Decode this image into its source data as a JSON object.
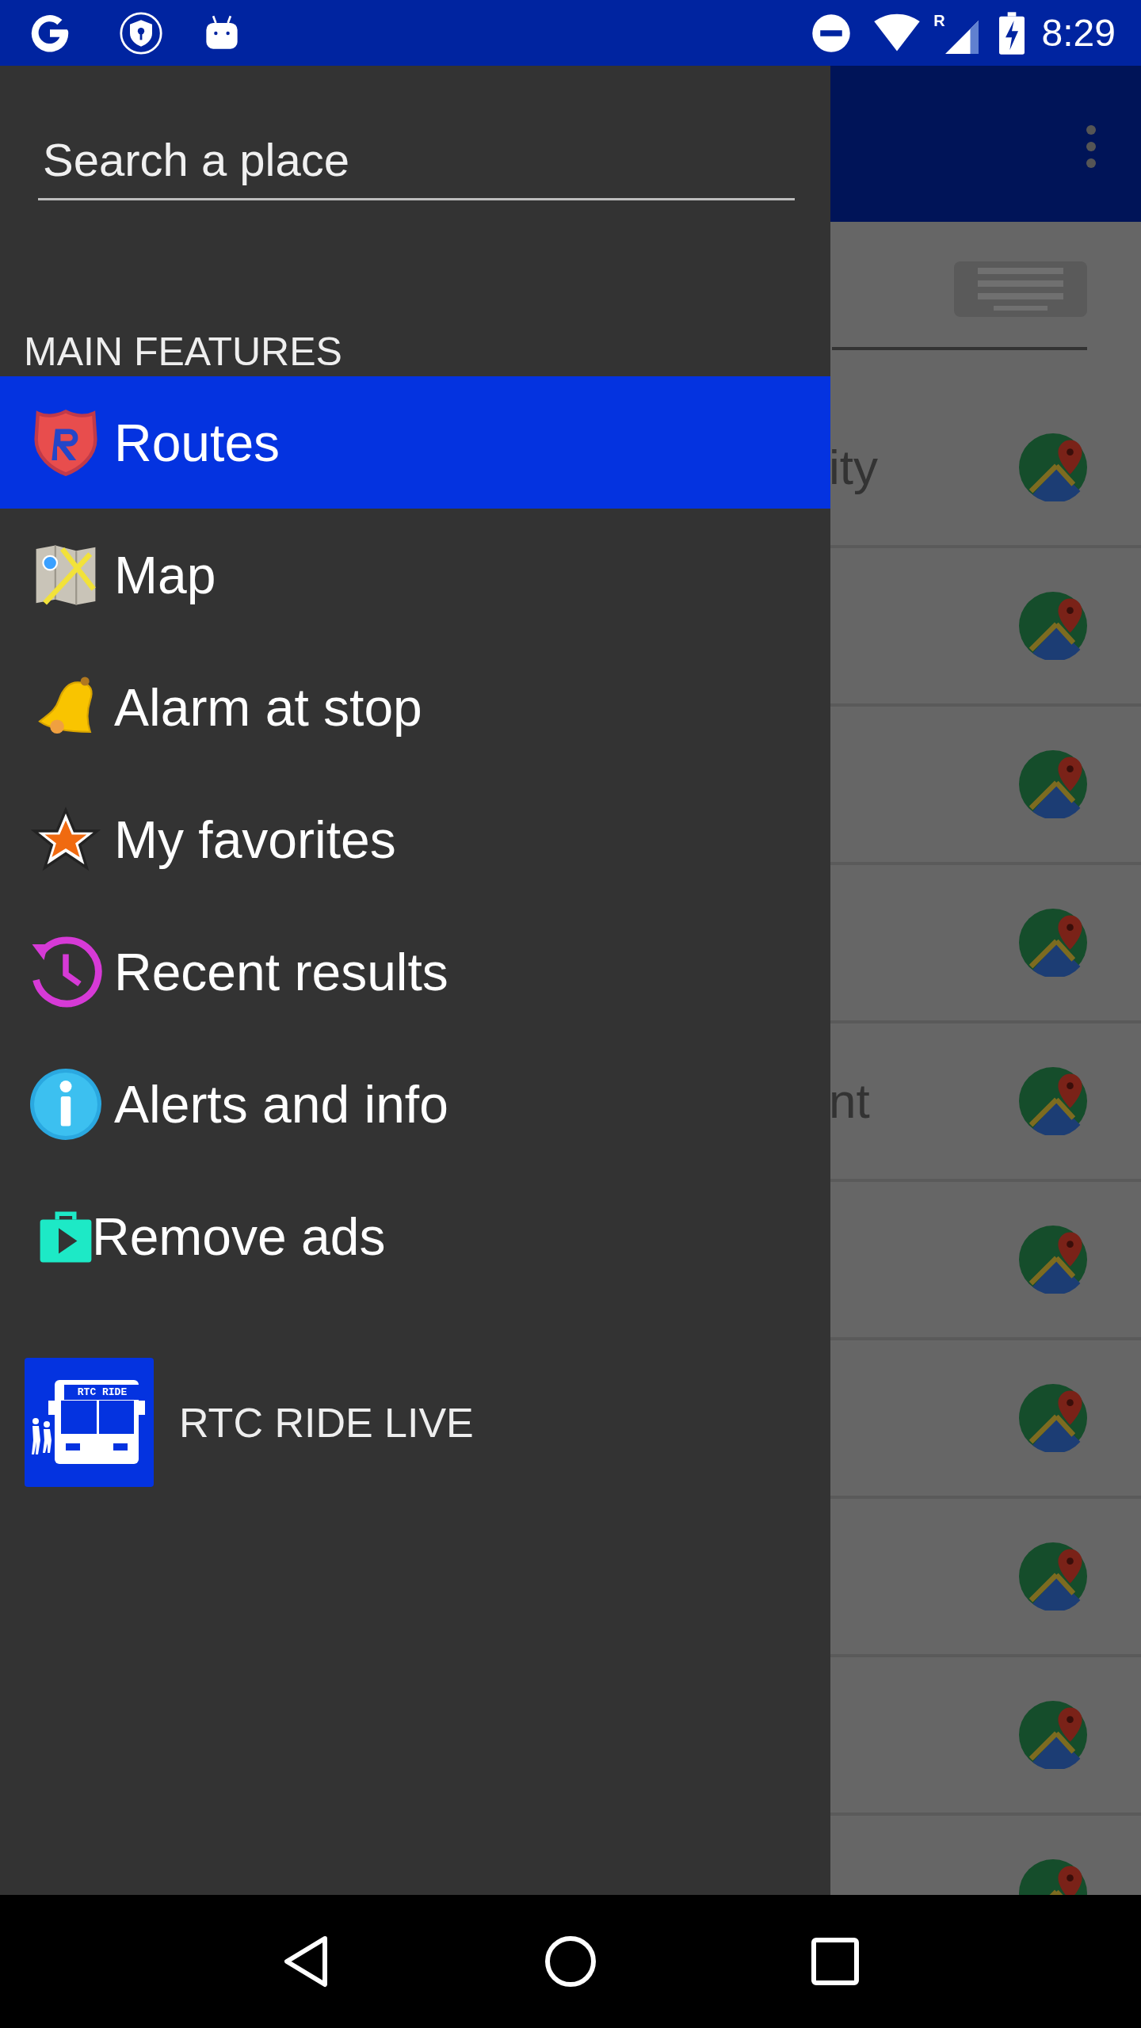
{
  "status_bar": {
    "time": "8:29",
    "signal_label": "R"
  },
  "behind_screen": {
    "rows": [
      {
        "kind": "row",
        "label": "ity"
      },
      {
        "kind": "row"
      },
      {
        "kind": "row"
      },
      {
        "kind": "row"
      },
      {
        "kind": "row",
        "label": "nt"
      },
      {
        "kind": "row"
      },
      {
        "kind": "row"
      },
      {
        "kind": "row"
      },
      {
        "kind": "row"
      },
      {
        "kind": "row"
      }
    ]
  },
  "drawer": {
    "search": {
      "placeholder": "Search a place"
    },
    "section_title": "MAIN FEATURES",
    "items": [
      {
        "label": "Routes",
        "kind": "routes",
        "selected": true
      },
      {
        "label": "Map",
        "kind": "map",
        "selected": false
      },
      {
        "label": "Alarm at stop",
        "kind": "bell",
        "selected": false
      },
      {
        "label": "My favorites",
        "kind": "star",
        "selected": false
      },
      {
        "label": "Recent results",
        "kind": "history",
        "selected": false
      },
      {
        "label": "Alerts and info",
        "kind": "info",
        "selected": false
      },
      {
        "label": "Remove ads",
        "kind": "store",
        "selected": false
      }
    ],
    "app": {
      "name": "RTC RIDE LIVE",
      "logo_text": "RTC RIDE"
    }
  }
}
